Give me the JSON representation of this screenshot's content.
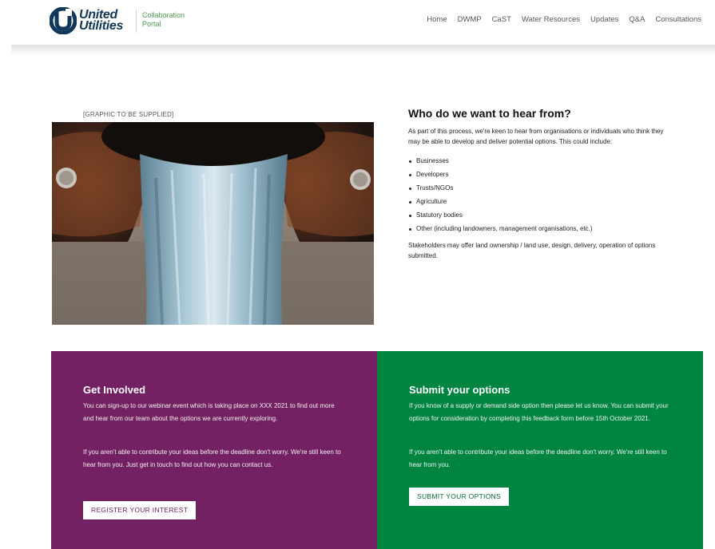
{
  "brand": {
    "name_line1": "United",
    "name_line2": "Utilities",
    "portal_line1": "Collaboration",
    "portal_line2": "Portal",
    "mark_color": "#10385b",
    "accent_color": "#4b9a4f"
  },
  "nav": {
    "items": [
      "Home",
      "DWMP",
      "CaST",
      "Water Resources",
      "Updates",
      "Q&A",
      "Consultations"
    ]
  },
  "main": {
    "graphic_note": "[GRAPHIC TO BE SUPPLIED]",
    "image_icon": "water-pipe-outflow-image",
    "who": {
      "heading": "Who do we want to hear from?",
      "intro": "As part of this process, we're keen to hear from organisations or individuals who think they may be able to develop and deliver potential options. This could include:",
      "list": [
        "Businesses",
        "Developers",
        "Trusts/NGOs",
        "Agriculture",
        "Statutory bodies",
        "Other (including landowners, management organisations, etc.)"
      ],
      "outro": "Stakeholders may offer land ownership / land use, design, delivery, operation of options submitted."
    }
  },
  "get_involved": {
    "heading": "Get Involved",
    "para1": "You can sign-up to our webinar event which is taking place on XXX 2021 to find out more and hear from our team about the options we are currently exploring.",
    "para2": "If you aren't able to contribute your ideas before the deadline don't worry. We're still keen to hear from you. Just get in touch to find out how you can contact us.",
    "button": "REGISTER YOUR INTEREST",
    "color": "#732162"
  },
  "submit_options": {
    "heading": "Submit your options",
    "para1": "If you know of a supply or demand side option then please let us know. You can submit your options for consideration by completing this feedback form before 15th October 2021.",
    "para2": "If you aren't able to contribute your ideas before the deadline don't worry. We're still keen to hear from you.",
    "button": "SUBMIT YOUR OPTIONS",
    "color": "#008540"
  }
}
